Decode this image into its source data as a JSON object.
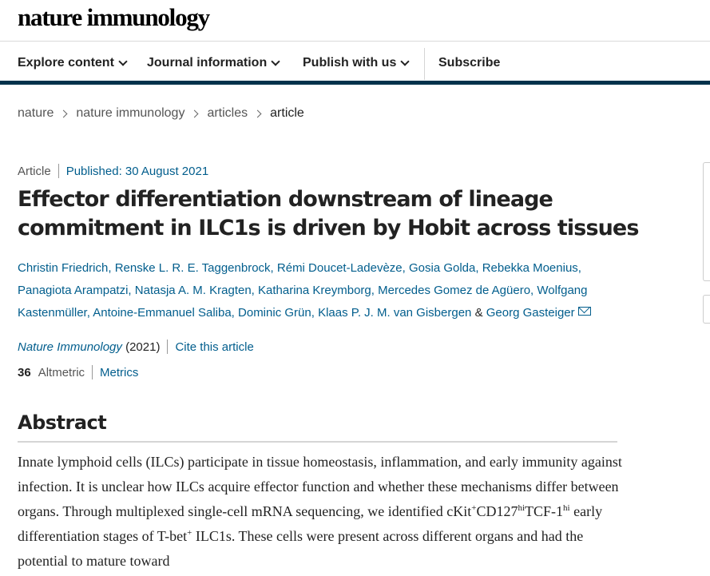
{
  "header": {
    "logo": "nature immunology"
  },
  "nav": {
    "explore": "Explore content",
    "journal_info": "Journal information",
    "publish": "Publish with us",
    "subscribe": "Subscribe"
  },
  "breadcrumb": [
    "nature",
    "nature immunology",
    "articles",
    "article"
  ],
  "article": {
    "type": "Article",
    "published": "Published: 30 August 2021",
    "title": "Effector differentiation downstream of lineage commitment in ILC1s is driven by Hobit across tissues",
    "authors": [
      "Christin Friedrich",
      "Renske L. R. E. Taggenbrock",
      "Rémi Doucet-Ladevèze",
      "Gosia Golda",
      "Rebekka Moenius",
      "Panagiota Arampatzi",
      "Natasja A. M. Kragten",
      "Katharina Kreymborg",
      "Mercedes Gomez de Agüero",
      "Wolfgang Kastenmüller",
      "Antoine-Emmanuel Saliba",
      "Dominic Grün",
      "Klaas P. J. M. van Gisbergen"
    ],
    "last_author": "Georg Gasteiger",
    "amp": "&",
    "journal": "Nature Immunology",
    "year": "(2021)",
    "cite": "Cite this article",
    "altmetric_score": "36",
    "altmetric_label": "Altmetric",
    "metrics": "Metrics"
  },
  "abstract": {
    "heading": "Abstract",
    "t1": "Innate lymphoid cells (ILCs) participate in tissue homeostasis, inflammation, and early immunity against infection. It is unclear how ILCs acquire effector function and whether these mechanisms differ between organs. Through multiplexed single-cell mRNA sequencing, we identified cKit",
    "s1": "+",
    "t2": "CD127",
    "s2": "hi",
    "t3": "TCF-1",
    "s3": "hi",
    "t4": " early differentiation stages of T-bet",
    "s4": "+",
    "t5": " ILC1s. These cells were present across different organs and had the potential to mature toward"
  }
}
